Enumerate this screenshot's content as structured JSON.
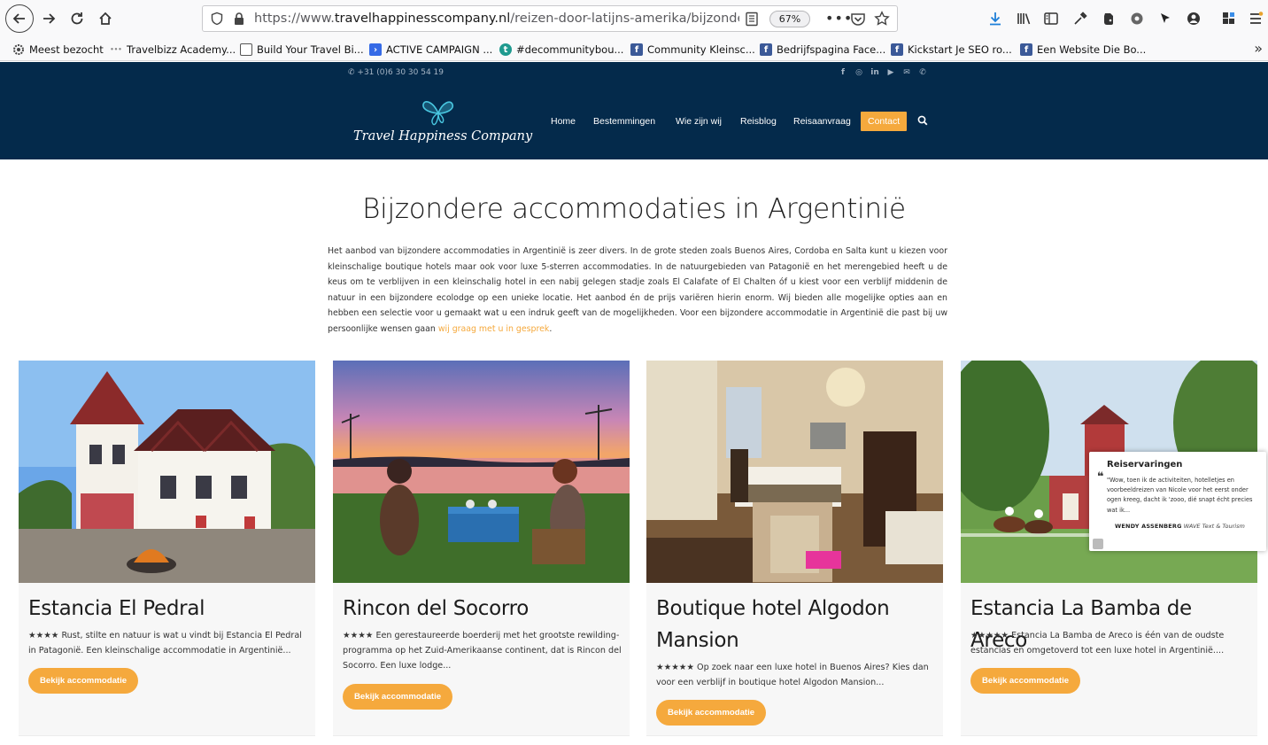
{
  "browser": {
    "url_prefix": "https://www.",
    "url_domain": "travelhappinesscompany.nl",
    "url_path": "/reizen-door-latijns-amerika/bijzondere-accom",
    "zoom": "67%",
    "bookmarks": [
      {
        "label": "Meest bezocht",
        "icon": "gear-icon"
      },
      {
        "label": "Travelbizz Academy...",
        "icon": "dots-icon"
      },
      {
        "label": "Build Your Travel Bi...",
        "icon": "frame-icon"
      },
      {
        "label": "ACTIVE CAMPAIGN ...",
        "icon": "activecampaign-icon"
      },
      {
        "label": "#decommunitybou...",
        "icon": "t-icon"
      },
      {
        "label": "Community Kleinsc...",
        "icon": "facebook-icon"
      },
      {
        "label": "Bedrijfspagina Face...",
        "icon": "facebook-icon"
      },
      {
        "label": "Kickstart Je SEO ro...",
        "icon": "facebook-icon"
      },
      {
        "label": "Een Website Die Bo...",
        "icon": "facebook-icon"
      }
    ]
  },
  "site": {
    "phone": "+31 (0)6 30 30 54 19",
    "logo_text": "Travel Happiness Company",
    "menu": [
      "Home",
      "Bestemmingen",
      "Wie zijn wij",
      "Reisblog",
      "Reisaanvraag",
      "Contact"
    ],
    "colors": {
      "navy": "#042a4b",
      "accent": "#f5a93d"
    }
  },
  "page": {
    "title": "Bijzondere accommodaties in Argentinië",
    "intro": "Het aanbod van bijzondere accommodaties in Argentinië is zeer divers. In de grote steden zoals Buenos Aires, Cordoba en Salta kunt u kiezen voor kleinschalige boutique hotels maar ook voor luxe 5-sterren accommodaties. In de natuurgebieden van Patagonië en het merengebied heeft u de keus om te verblijven in een kleinschalig hotel in een nabij gelegen stadje zoals El Calafate of El Chalten óf u kiest voor een verblijf middenin de natuur in een bijzondere ecolodge op een unieke locatie. Het aanbod én de prijs variëren hierin enorm. Wij bieden alle mogelijke opties aan en hebben een selectie voor u gemaakt wat u een indruk geeft van de mogelijkheden. Voor een bijzondere accommodatie in Argentinië die past bij uw persoonlijke wensen gaan ",
    "intro_link": "wij graag met u in gesprek",
    "intro_end": "."
  },
  "cards": [
    {
      "title": "Estancia El Pedral",
      "desc": "★★★★ Rust, stilte en natuur is wat u vindt bij Estancia El Pedral in Patagonië. Een kleinschalige accommodatie in Argentinië...",
      "button": "Bekijk accommodatie"
    },
    {
      "title": "Rincon del Socorro",
      "desc": "★★★★ Een gerestaureerde boerderij met het grootste rewilding-programma op het Zuid-Amerikaanse continent, dat is Rincon del Socorro. Een luxe lodge...",
      "button": "Bekijk accommodatie"
    },
    {
      "title": "Boutique hotel Algodon Mansion",
      "desc": "★★★★★ Op zoek naar een luxe hotel in Buenos Aires? Kies dan voor een verblijf in boutique hotel Algodon Mansion...",
      "button": "Bekijk accommodatie"
    },
    {
      "title": "Estancia La Bamba de Areco",
      "desc": "★★★★★ Estancia La Bamba de Areco is één van de oudste estancias en omgetoverd tot een luxe hotel in Argentinië....",
      "button": "Bekijk accommodatie"
    }
  ],
  "review": {
    "title": "Reiservaringen",
    "quote_mark": "❝",
    "text": "\"Wow, toen ik de activiteiten, hotelletjes en voorbeeldreizen van Nicole voor het eerst onder ogen kreeg, dacht ik 'zooo, dié snapt écht precies wat ik...",
    "author": "WENDY ASSENBERG",
    "company": "WAVE Text & Tourism"
  }
}
